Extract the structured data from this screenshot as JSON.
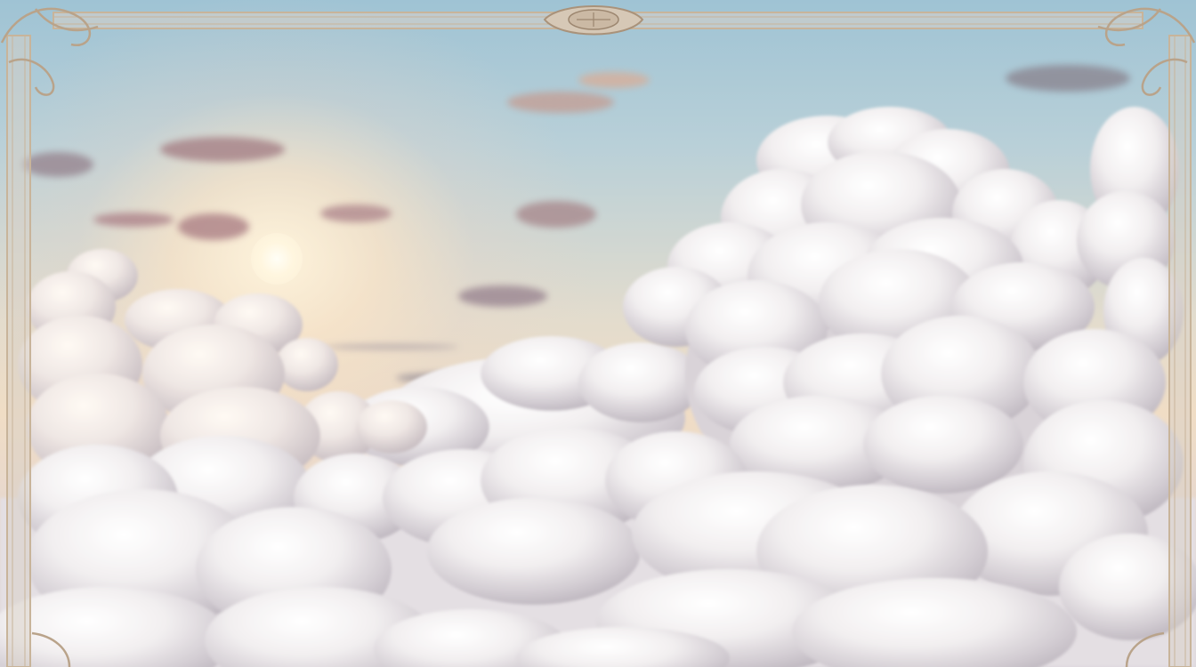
{
  "image": {
    "subject": "sky-with-cumulus-clouds",
    "elements": [
      "sun",
      "wispy-clouds",
      "cumulus-cloud-bank",
      "ornate-frame"
    ],
    "colors": {
      "sky_top": "#9fc3d4",
      "sky_glow": "#f0ddc5",
      "cloud_light": "#f4f1f2",
      "cloud_shadow": "#c9c2c9",
      "frame_gold": "#c8b49a"
    }
  }
}
